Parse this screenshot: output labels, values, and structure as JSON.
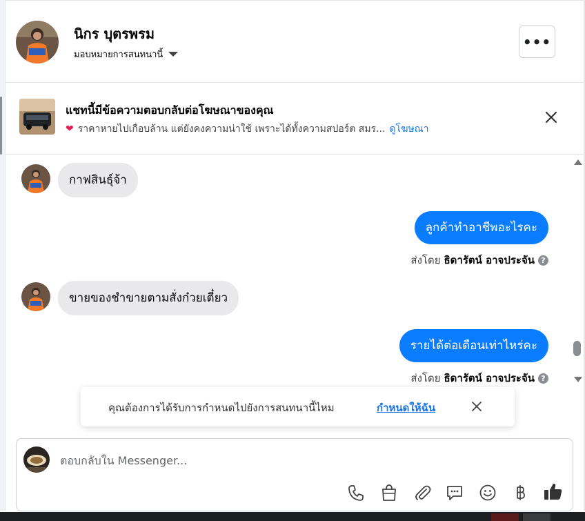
{
  "header": {
    "name": "นิกร บุตรพรม",
    "assign_label": "มอบหมายการสนทนานี้",
    "more_label": "•••"
  },
  "ad_banner": {
    "title": "แชทนี้มีข้อความตอบกลับต่อโฆษณาของคุณ",
    "text": "ราคาหายไปเกือบล้าน แต่ยังคงความน่าใช้ เพราะได้ทั้งความสปอร์ต สมร...",
    "link": "ดูโฆษณา"
  },
  "messages": [
    {
      "direction": "in",
      "text": "กาฟสินธุ์จ้า"
    },
    {
      "direction": "out",
      "text": "ลูกค้าทำอาชีพอะไรคะ",
      "sent_by_prefix": "ส่งโดย",
      "sent_by_name": "ธิดารัตน์ อาจประจัน"
    },
    {
      "direction": "in",
      "text": "ขายของชำขายตามสั่งก๋วยเตี๋ยว"
    },
    {
      "direction": "out",
      "text": "รายได้ต่อเดือนเท่าไหร่คะ",
      "sent_by_prefix": "ส่งโดย",
      "sent_by_name": "ธิดารัตน์ อาจประจัน"
    }
  ],
  "toast": {
    "text": "คุณต้องการได้รับการกำหนดไปยังการสนทนานี้ไหม",
    "link": "กำหนดให้ฉัน"
  },
  "composer": {
    "placeholder": "ตอบกลับใน Messenger..."
  },
  "colors": {
    "accent": "#0a7cff",
    "link": "#1b74e4",
    "incoming_bubble": "#e9e9eb"
  },
  "icons": [
    "phone-icon",
    "shopping-bag-icon",
    "paperclip-icon",
    "saved-reply-icon",
    "emoji-icon",
    "baht-icon",
    "thumbs-up-icon"
  ]
}
